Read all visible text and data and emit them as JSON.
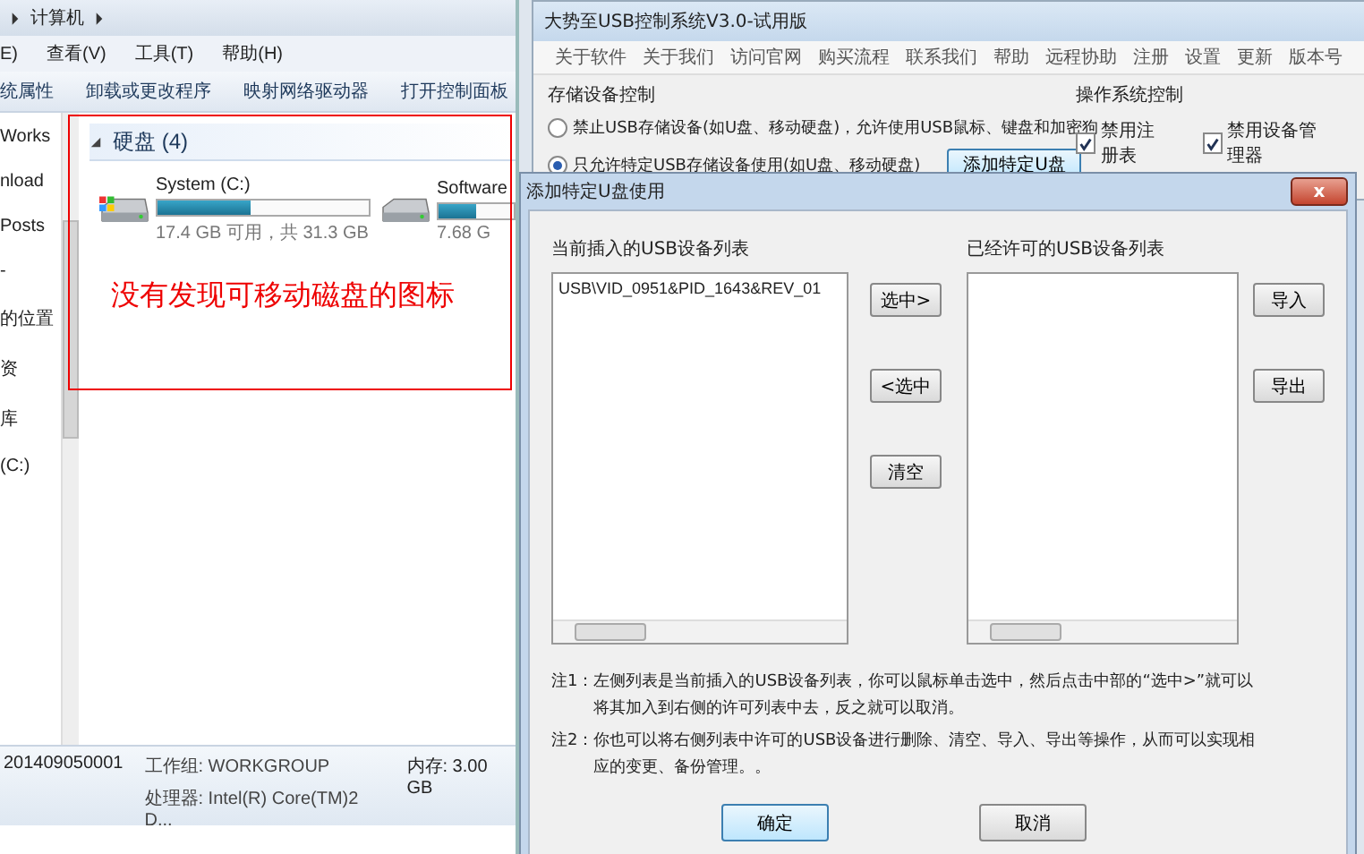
{
  "explorer": {
    "breadcrumb": "计算机",
    "menu": [
      "E)",
      "查看(V)",
      "工具(T)",
      "帮助(H)"
    ],
    "toolbar": [
      "统属性",
      "卸载或更改程序",
      "映射网络驱动器",
      "打开控制面板"
    ],
    "nav_items": [
      "Works",
      "nload",
      "Posts",
      "-",
      "的位置",
      "资",
      "库",
      "(C:)"
    ],
    "group": {
      "title": "硬盘 (4)",
      "expanded": true
    },
    "drives": [
      {
        "name": "System (C:)",
        "level": 0.44,
        "info": "17.4 GB 可用，共 31.3 GB",
        "kind": "system"
      },
      {
        "name": "Software",
        "level": 0.5,
        "info": "7.68 G",
        "kind": "plain"
      }
    ],
    "details": {
      "computer": "201409050001",
      "workgroup": "工作组: WORKGROUP",
      "memory": "内存: 3.00 GB",
      "processor": "处理器: Intel(R) Core(TM)2 D..."
    }
  },
  "annotation": {
    "text": "没有发现可移动磁盘的图标"
  },
  "usb_window": {
    "title": "大势至USB控制系统V3.0-试用版",
    "menu": [
      "关于软件",
      "关于我们",
      "访问官网",
      "购买流程",
      "联系我们",
      "帮助",
      "远程协助",
      "注册",
      "设置",
      "更新",
      "版本号"
    ],
    "storage_group": "存储设备控制",
    "radios": [
      {
        "label": "禁止USB存储设备(如U盘、移动硬盘)，允许使用USB鼠标、键盘和加密狗",
        "selected": false
      },
      {
        "label": "只允许特定USB存储设备使用(如U盘、移动硬盘)",
        "selected": true
      }
    ],
    "add_button": "添加特定U盘",
    "os_group": "操作系统控制",
    "checkboxes": [
      {
        "label": "禁用注册表",
        "checked": true
      },
      {
        "label": "禁用设备管理器",
        "checked": true
      }
    ]
  },
  "dialog": {
    "title": "添加特定U盘使用",
    "close": "x",
    "left_list": {
      "label": "当前插入的USB设备列表",
      "items": [
        "USB\\VID_0951&PID_1643&REV_01"
      ]
    },
    "middle_buttons": [
      "选中>",
      "<选中",
      "清空"
    ],
    "right_list": {
      "label": "已经许可的USB设备列表"
    },
    "right_buttons": [
      "导入",
      "导出"
    ],
    "notes": [
      {
        "label": "注1：",
        "text": "左侧列表是当前插入的USB设备列表，你可以鼠标单击选中，然后点击中部的“选中>”就可以将其加入到右侧的许可列表中去，反之就可以取消。"
      },
      {
        "label": "注2：",
        "text": "你也可以将右侧列表中许可的USB设备进行删除、清空、导入、导出等操作，从而可以实现相应的变更、备份管理。。"
      }
    ],
    "buttons": [
      {
        "label": "确定",
        "selected": true
      },
      {
        "label": "取消",
        "selected": false
      }
    ]
  }
}
